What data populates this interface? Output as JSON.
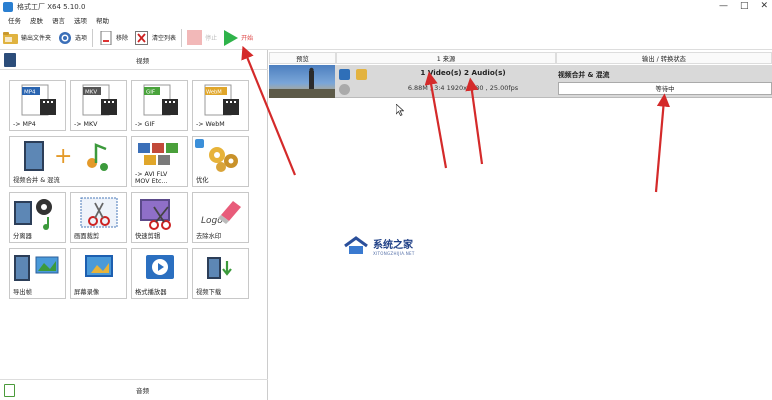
{
  "window": {
    "title": "格式工厂 X64 5.10.0",
    "controls": [
      "—",
      "□",
      "✕"
    ]
  },
  "menu": [
    "任务",
    "皮肤",
    "语言",
    "选项",
    "帮助"
  ],
  "toolbar": {
    "output_folder": "输出文件夹",
    "options": "选项",
    "remove": "移除",
    "clear_list": "清空列表",
    "stop": "停止",
    "start": "开始"
  },
  "sidebar": {
    "video_category": "视频",
    "audio_category": "音频",
    "tiles": [
      {
        "label": "-> MP4",
        "badge": "MP4"
      },
      {
        "label": "-> MKV",
        "badge": "MKV"
      },
      {
        "label": "-> GIF",
        "badge": "GIF"
      },
      {
        "label": "-> WebM",
        "badge": "WebM"
      },
      {
        "label": "视频合并 & 混流"
      },
      {
        "label": "-> AVI FLV\nMOV Etc..."
      },
      {
        "label": "优化"
      },
      {
        "label": "分离器"
      },
      {
        "label": "画面裁剪"
      },
      {
        "label": "快速剪辑"
      },
      {
        "label": "去除水印",
        "badge": "Logo"
      },
      {
        "label": "导出帧"
      },
      {
        "label": "屏幕录像"
      },
      {
        "label": "格式播放器"
      },
      {
        "label": "视频下载"
      }
    ]
  },
  "task_list": {
    "columns": {
      "preview": "预览",
      "source": "1 来源",
      "output": "输出 / 转换状态"
    },
    "rows": [
      {
        "source_title": "1 Video(s) 2 Audio(s)",
        "source_info": "6.88M , 3:4 1920x1080 , 25.00fps",
        "output_title": "视频合并 & 混流",
        "status": "等待中"
      }
    ]
  },
  "watermark": {
    "name": "系统之家",
    "url": "XITONGZHIJIA.NET"
  },
  "colors": {
    "arrow": "#d42a2a",
    "start_green": "#2fb34a",
    "row_bg": "#d9d9d9"
  }
}
